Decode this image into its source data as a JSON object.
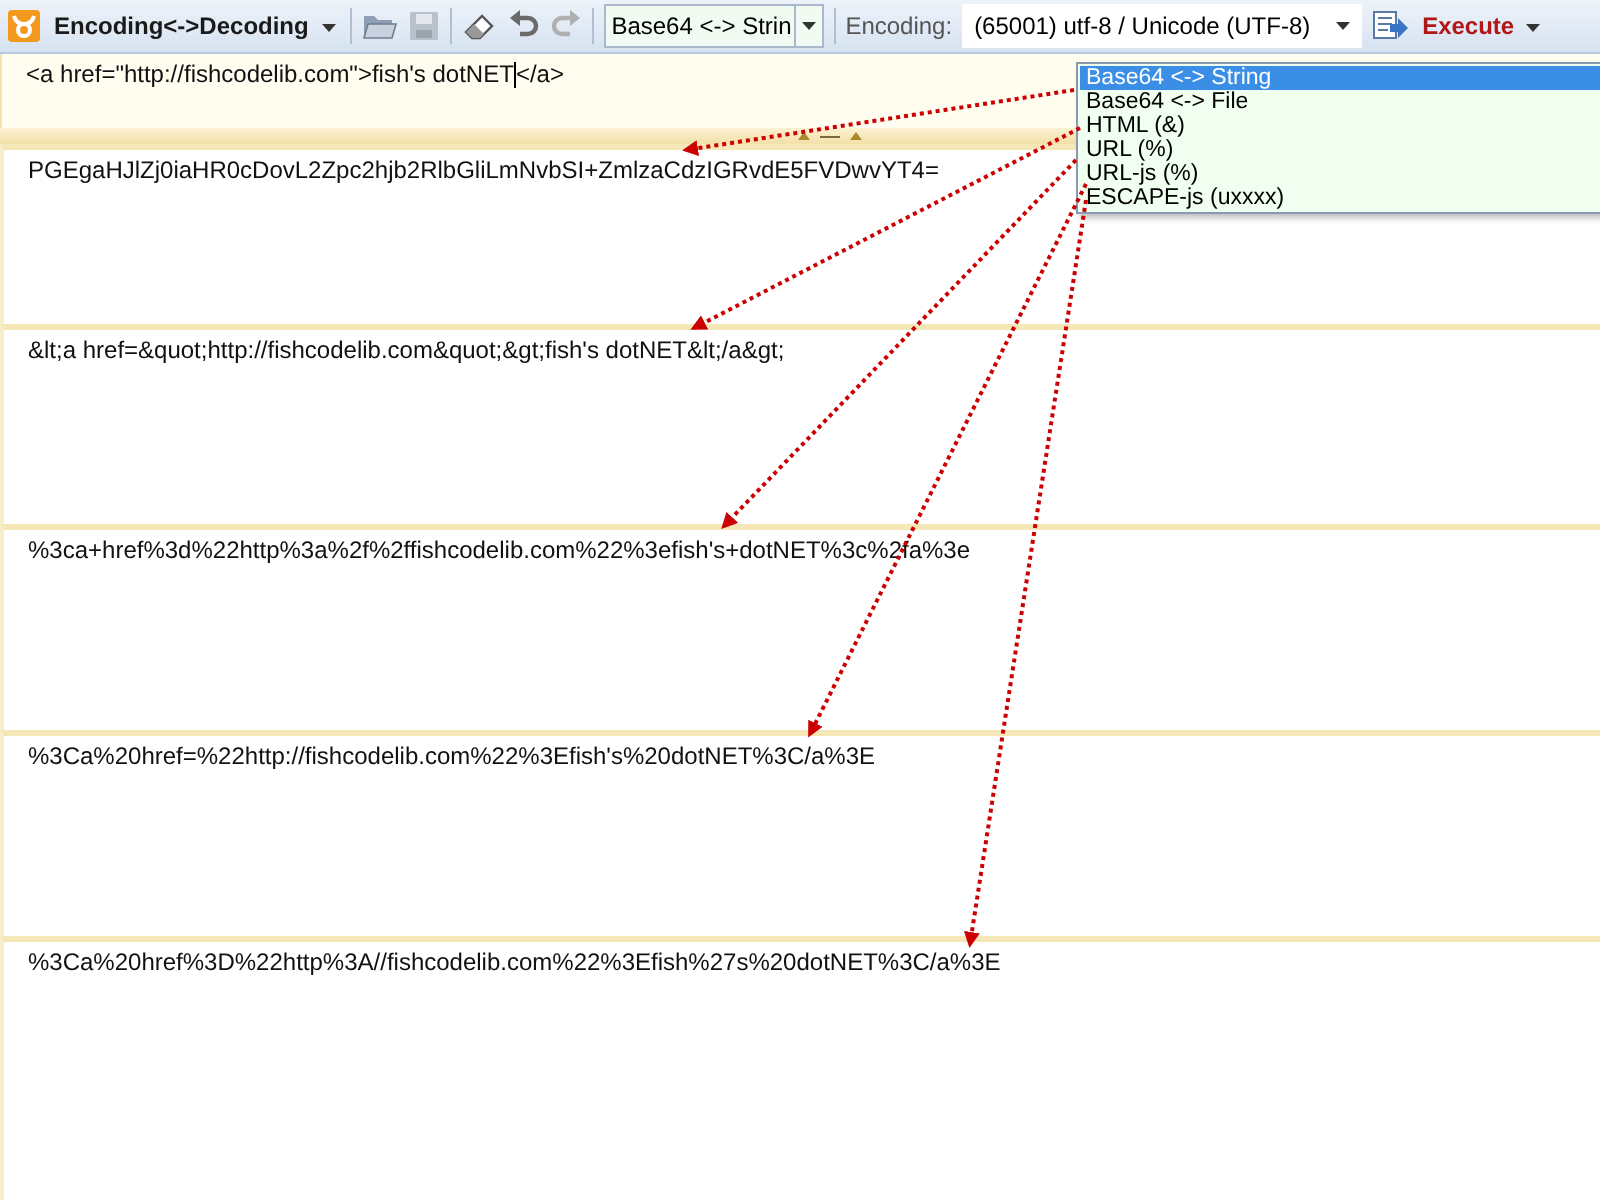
{
  "toolbar": {
    "mode_menu": "Encoding<->Decoding",
    "method_combo": "Base64 <-> Strin",
    "encoding_label": "Encoding:",
    "encoding_value": "(65001) utf-8 / Unicode (UTF-8)",
    "execute": "Execute"
  },
  "input": {
    "before_cursor": "<a href=\"http://fishcodelib.com\">fish's dotNET",
    "after_cursor": "</a>"
  },
  "outputs": [
    {
      "text": "PGEgaHJlZj0iaHR0cDovL2Zpc2hjb2RlbGliLmNvbSI+ZmlzaCdzIGRvdE5FVDwvYT4="
    },
    {
      "text": "&lt;a href=&quot;http://fishcodelib.com&quot;&gt;fish's dotNET&lt;/a&gt;"
    },
    {
      "text": "%3ca+href%3d%22http%3a%2f%2ffishcodelib.com%22%3efish's+dotNET%3c%2fa%3e"
    },
    {
      "text": "%3Ca%20href=%22http://fishcodelib.com%22%3Efish's%20dotNET%3C/a%3E"
    },
    {
      "text": "%3Ca%20href%3D%22http%3A//fishcodelib.com%22%3Efish%27s%20dotNET%3C/a%3E"
    }
  ],
  "dropdown": [
    {
      "label": "Base64 <-> String",
      "selected": true
    },
    {
      "label": "Base64 <-> File",
      "selected": false
    },
    {
      "label": "HTML (&)",
      "selected": false
    },
    {
      "label": "URL (%)",
      "selected": false
    },
    {
      "label": "URL-js (%)",
      "selected": false
    },
    {
      "label": "ESCAPE-js (uxxxx)",
      "selected": false
    }
  ]
}
